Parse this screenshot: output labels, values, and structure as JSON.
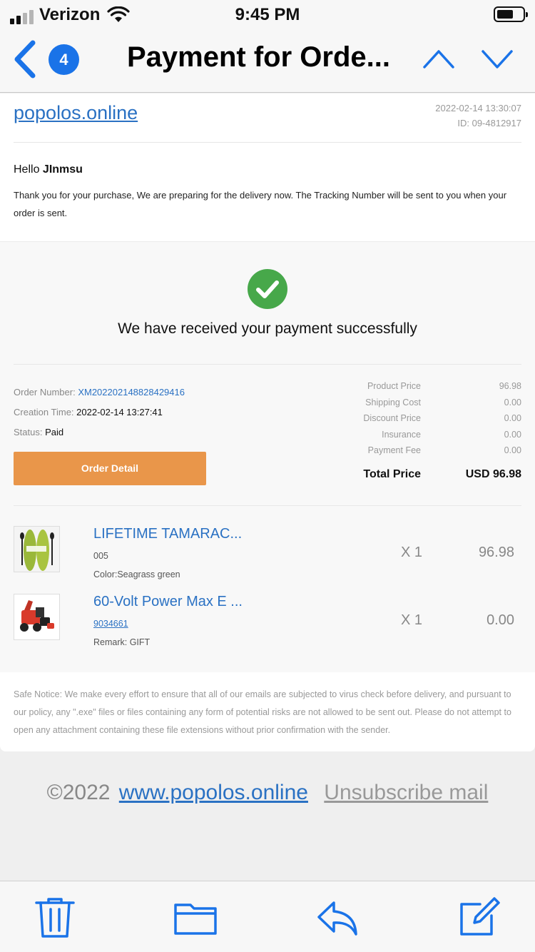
{
  "status_bar": {
    "carrier": "Verizon",
    "time": "9:45 PM"
  },
  "header": {
    "badge_count": "4",
    "title": "Payment for Orde..."
  },
  "email": {
    "sender": "popolos.online",
    "date": "2022-02-14 13:30:07",
    "id": "ID: 09-4812917",
    "greeting_prefix": "Hello",
    "greeting_name": "JInmsu",
    "intro": "Thank you for your purchase, We are preparing for the delivery now. The Tracking Number will be sent to you when your order is sent.",
    "success_message": "We have received your payment successfully",
    "order": {
      "number_label": "Order Number:",
      "number": "XM202202148828429416",
      "time_label": "Creation Time:",
      "time": "2022-02-14 13:27:41",
      "status_label": "Status:",
      "status": "Paid",
      "detail_button": "Order Detail"
    },
    "prices": [
      {
        "label": "Product Price",
        "value": "96.98"
      },
      {
        "label": "Shipping Cost",
        "value": "0.00"
      },
      {
        "label": "Discount Price",
        "value": "0.00"
      },
      {
        "label": "Insurance",
        "value": "0.00"
      },
      {
        "label": "Payment Fee",
        "value": "0.00"
      }
    ],
    "total_label": "Total Price",
    "total_value": "USD 96.98",
    "items": [
      {
        "name": "LIFETIME TAMARAC...",
        "sku": "005",
        "detail": "Color:Seagrass green",
        "qty": "X 1",
        "price": "96.98"
      },
      {
        "name": "60-Volt Power Max E ...",
        "sku": "9034661",
        "detail": "Remark: GIFT",
        "qty": "X 1",
        "price": "0.00"
      }
    ],
    "safe_notice": "Safe Notice: We make every effort to ensure that all of our emails are subjected to virus check before delivery, and pursuant to our policy, any \".exe\" files or files containing any form of potential risks are not allowed to be sent out. Please do not attempt to open any attachment containing these file extensions without prior confirmation with the sender."
  },
  "footer": {
    "copyright": "©2022",
    "site": "www.popolos.online",
    "unsubscribe": "Unsubscribe mail"
  },
  "toolbar": {
    "icons": [
      "trash-icon",
      "folder-icon",
      "reply-icon",
      "compose-icon"
    ]
  },
  "colors": {
    "accent": "#1a73e8",
    "link": "#2a71c3",
    "success": "#47a84a",
    "button": "#e9964a"
  }
}
